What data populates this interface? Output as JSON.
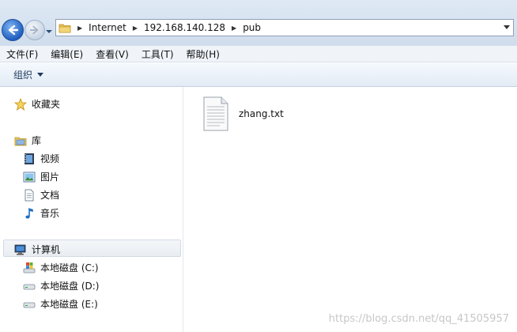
{
  "address_bar": {
    "breadcrumbs": [
      "Internet",
      "192.168.140.128",
      "pub"
    ]
  },
  "menu": {
    "items": [
      "文件(F)",
      "编辑(E)",
      "查看(V)",
      "工具(T)",
      "帮助(H)"
    ]
  },
  "toolbar": {
    "organize_label": "组织"
  },
  "nav_pane": {
    "favorites": "收藏夹",
    "libraries": {
      "label": "库",
      "items": [
        "视频",
        "图片",
        "文档",
        "音乐"
      ]
    },
    "computer": {
      "label": "计算机",
      "drives": [
        "本地磁盘 (C:)",
        "本地磁盘 (D:)",
        "本地磁盘 (E:)"
      ]
    }
  },
  "content": {
    "files": [
      {
        "name": "zhang.txt",
        "icon": "text-file-icon"
      }
    ]
  },
  "watermark": "https://blog.csdn.net/qq_41505957"
}
